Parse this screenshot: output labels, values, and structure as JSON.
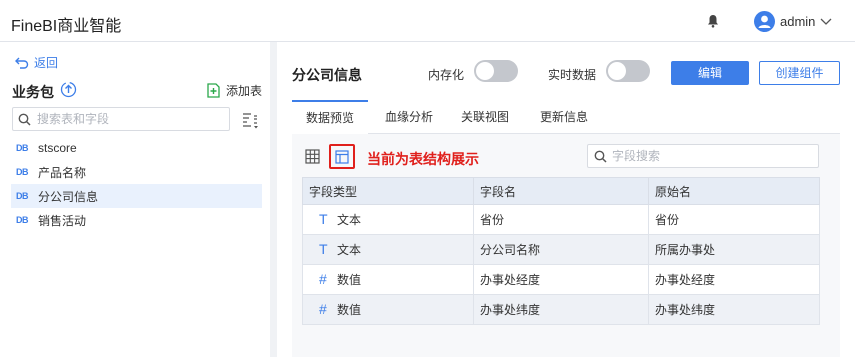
{
  "app": {
    "title": "FineBI商业智能",
    "username": "admin"
  },
  "sidebar": {
    "back_label": "返回",
    "package_title": "业务包",
    "add_table_label": "添加表",
    "search_placeholder": "搜索表和字段",
    "tables": [
      {
        "tag": "DB",
        "label": "stscore"
      },
      {
        "tag": "DB",
        "label": "产品名称"
      },
      {
        "tag": "DB",
        "label": "分公司信息"
      },
      {
        "tag": "DB",
        "label": "销售活动"
      }
    ]
  },
  "main": {
    "title": "分公司信息",
    "memory_label": "内存化",
    "realtime_label": "实时数据",
    "edit_label": "编辑",
    "create_component_label": "创建组件",
    "tabs": [
      "数据预览",
      "血缘分析",
      "关联视图",
      "更新信息"
    ],
    "annotation": "当前为表结构展示",
    "field_search_placeholder": "字段搜索",
    "table": {
      "headers": [
        "字段类型",
        "字段名",
        "原始名"
      ],
      "rows": [
        {
          "icon": "T",
          "type": "文本",
          "name": "省份",
          "original": "省份"
        },
        {
          "icon": "T",
          "type": "文本",
          "name": "分公司名称",
          "original": "所属办事处"
        },
        {
          "icon": "#",
          "type": "数值",
          "name": "办事处经度",
          "original": "办事处经度"
        },
        {
          "icon": "#",
          "type": "数值",
          "name": "办事处纬度",
          "original": "办事处纬度"
        }
      ]
    }
  },
  "colors": {
    "accent": "#3d7ee8",
    "annotation": "#e0201c"
  }
}
